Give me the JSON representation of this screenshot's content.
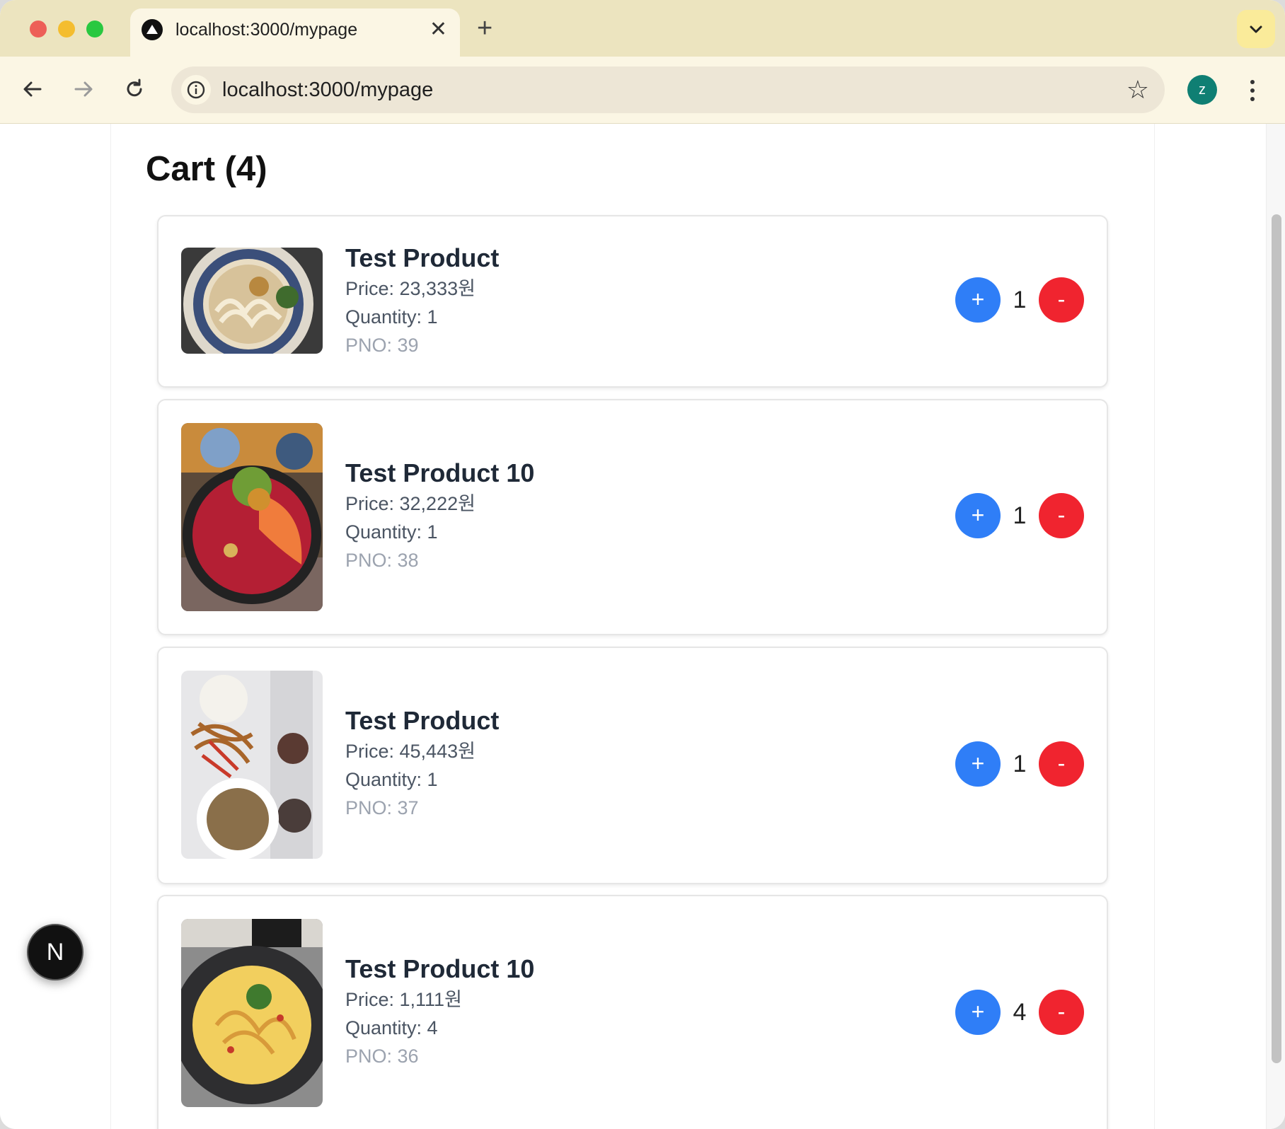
{
  "browser": {
    "tab_title": "localhost:3000/mypage",
    "url": "localhost:3000/mypage",
    "profile_initial": "z"
  },
  "page": {
    "cart_title": "Cart (4)",
    "items": [
      {
        "name": "Test Product",
        "price": "Price: 23,333원",
        "quantity_text": "Quantity: 1",
        "pno": "PNO: 39",
        "qty": "1",
        "plus_label": "+",
        "minus_label": "-",
        "image": "udon noodles in bowl"
      },
      {
        "name": "Test Product 10",
        "price": "Price: 32,222원",
        "quantity_text": "Quantity: 1",
        "pno": "PNO: 38",
        "qty": "1",
        "plus_label": "+",
        "minus_label": "-",
        "image": "tuna and salmon rice bowl"
      },
      {
        "name": "Test Product",
        "price": "Price: 45,443원",
        "quantity_text": "Quantity: 1",
        "pno": "PNO: 37",
        "qty": "1",
        "plus_label": "+",
        "minus_label": "-",
        "image": "plate with noodles and soup cup"
      },
      {
        "name": "Test Product 10",
        "price": "Price: 1,111원",
        "quantity_text": "Quantity: 4",
        "pno": "PNO: 36",
        "qty": "4",
        "plus_label": "+",
        "minus_label": "-",
        "image": "cream pasta in dark plate"
      }
    ]
  },
  "dev_badge": {
    "label": "N"
  },
  "colors": {
    "plus_button": "#2f7ef7",
    "minus_button": "#f0242f",
    "tab_strip": "#ece4bf",
    "toolbar": "#fbf6e4"
  }
}
